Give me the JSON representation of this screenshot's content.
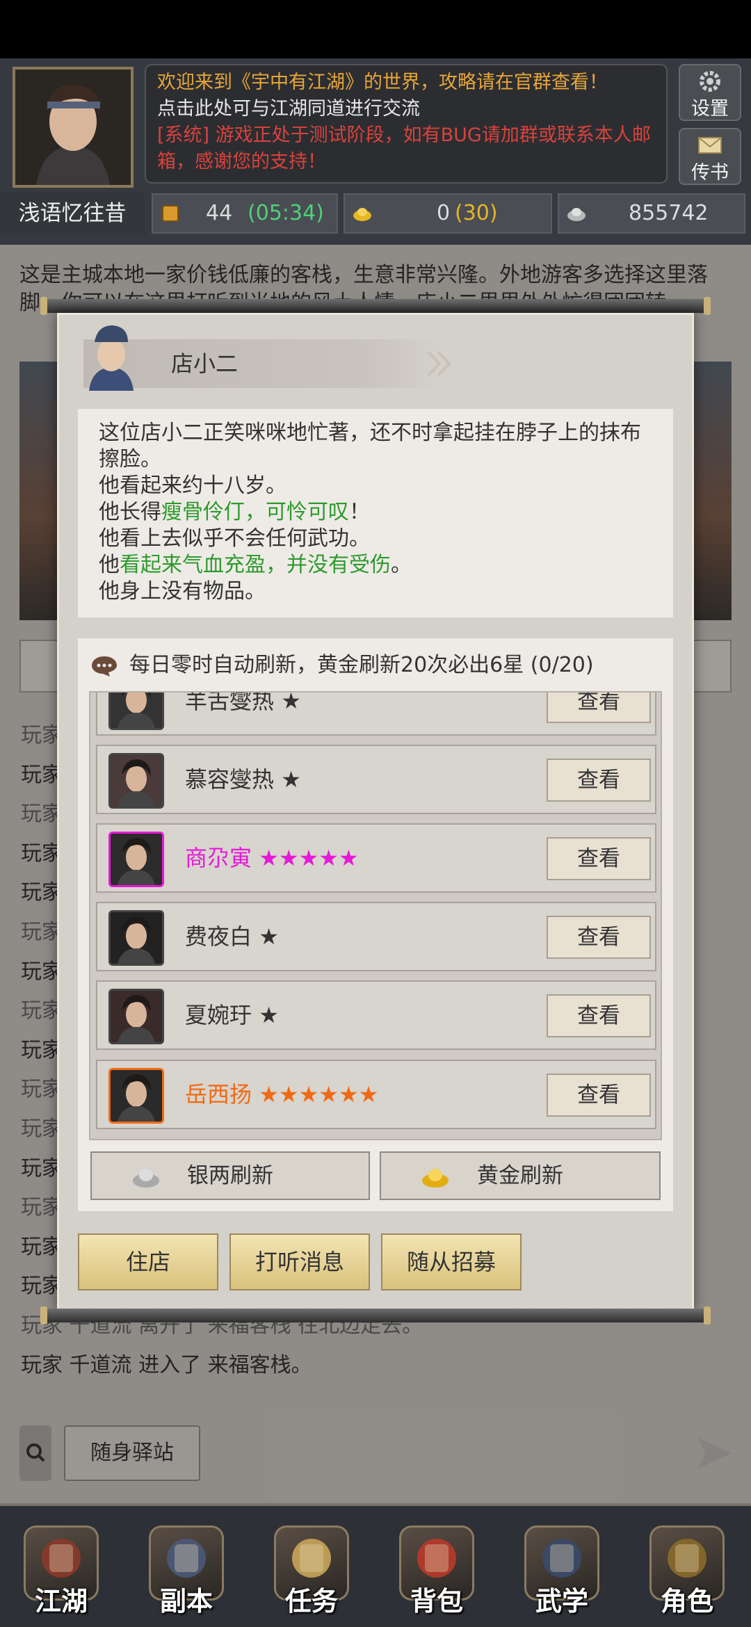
{
  "header": {
    "messages": {
      "line1": "欢迎来到《宇中有江湖》的世界，攻略请在官群查看！",
      "line2": "点击此处可与江湖同道进行交流",
      "line3": "[系统] 游戏正处于测试阶段，如有BUG请加群或联系本人邮箱，感谢您的支持！"
    },
    "settings_label": "设置",
    "mail_label": "传书",
    "username": "浅语忆往昔",
    "resources": {
      "stamina": "44",
      "stamina_timer": "(05:34)",
      "gold": "0",
      "gold_extra": "(30)",
      "silver": "855742"
    }
  },
  "scene": {
    "description": "这是主城本地一家价钱低廉的客栈，生意非常兴隆。外地游客多选择这里落脚，你可以在这里打听到当地的风土人情。店小二里里外外忙得团团转。",
    "log": [
      {
        "text": "玩家",
        "dark": false
      },
      {
        "text": "玩家",
        "dark": true
      },
      {
        "text": "玩家",
        "dark": false
      },
      {
        "text": "玩家",
        "dark": true
      },
      {
        "text": "玩家",
        "dark": true
      },
      {
        "text": "玩家",
        "dark": false
      },
      {
        "text": "玩家",
        "dark": true
      },
      {
        "text": "玩家",
        "dark": false
      },
      {
        "text": "玩家",
        "dark": true
      },
      {
        "text": "玩家",
        "dark": false
      },
      {
        "text": "玩家",
        "dark": false
      },
      {
        "text": "玩家",
        "dark": true
      },
      {
        "text": "玩家",
        "dark": false
      },
      {
        "text": "玩家",
        "dark": true
      },
      {
        "text": "玩家",
        "dark": true
      },
      {
        "text": "玩家 千道流 离开了 来福客栈 往北边走去。",
        "dark": false
      },
      {
        "text": "玩家 千道流 进入了 来福客栈。",
        "dark": true
      }
    ],
    "station_button": "随身驿站"
  },
  "dialog": {
    "npc_name": "店小二",
    "desc": {
      "l1": "这位店小二正笑咪咪地忙著，还不时拿起挂在脖子上的抹布擦脸。",
      "l2": "他看起来约十八岁。",
      "l3a": "他长得",
      "l3b": "瘦骨伶仃，可怜可叹",
      "l3c": "！",
      "l4": "他看上去似乎不会任何武功。",
      "l5a": "他",
      "l5b": "看起来气血充盈，并没有受伤",
      "l5c": "。",
      "l6": "他身上没有物品。"
    },
    "refresh_tip": "每日零时自动刷新，黄金刷新20次必出6星 (0/20)",
    "recruits": [
      {
        "name": "羊舌燮热",
        "stars": "★",
        "rarity": "normal",
        "button": "查看"
      },
      {
        "name": "慕容燮热",
        "stars": "★",
        "rarity": "normal",
        "button": "查看"
      },
      {
        "name": "商尕寅",
        "stars": "★★★★★",
        "rarity": "purple",
        "button": "查看"
      },
      {
        "name": "费夜白",
        "stars": "★",
        "rarity": "normal",
        "button": "查看"
      },
      {
        "name": "夏婉玗",
        "stars": "★",
        "rarity": "normal",
        "button": "查看"
      },
      {
        "name": "岳西扬",
        "stars": "★★★★★★",
        "rarity": "orange",
        "button": "查看"
      }
    ],
    "silver_refresh": "银两刷新",
    "gold_refresh": "黄金刷新",
    "actions": [
      "住店",
      "打听消息",
      "随从招募"
    ]
  },
  "nav": [
    {
      "label": "江湖",
      "icon": "pagoda-icon"
    },
    {
      "label": "副本",
      "icon": "sword-icon"
    },
    {
      "label": "任务",
      "icon": "scroll-icon"
    },
    {
      "label": "背包",
      "icon": "bag-icon"
    },
    {
      "label": "武学",
      "icon": "book-icon"
    },
    {
      "label": "角色",
      "icon": "gourd-icon"
    }
  ],
  "colors": {
    "purple_rarity": "#e51ad6",
    "orange_rarity": "#f06a14",
    "heal_green": "#2d9a2d",
    "system_red": "#d8433c",
    "welcome_orange": "#e6a63a"
  }
}
